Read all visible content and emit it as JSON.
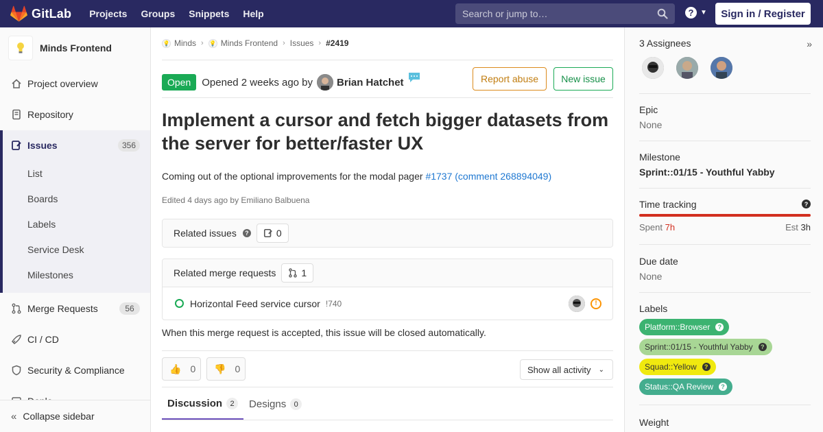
{
  "navbar": {
    "brand": "GitLab",
    "links": [
      "Projects",
      "Groups",
      "Snippets",
      "Help"
    ],
    "search_placeholder": "Search or jump to…",
    "signin": "Sign in / Register"
  },
  "sidebar": {
    "project_name": "Minds Frontend",
    "items": {
      "overview": "Project overview",
      "repository": "Repository",
      "issues": "Issues",
      "issues_count": "356",
      "merge_requests": "Merge Requests",
      "mr_count": "56",
      "cicd": "CI / CD",
      "security": "Security & Compliance",
      "deploy_partial": "Deplo"
    },
    "issue_subitems": [
      "List",
      "Boards",
      "Labels",
      "Service Desk",
      "Milestones"
    ],
    "collapse": "Collapse sidebar"
  },
  "breadcrumb": {
    "group": "Minds",
    "project": "Minds Frontend",
    "section": "Issues",
    "current": "#2419"
  },
  "issue": {
    "state": "Open",
    "opened_text": "Opened 2 weeks ago by",
    "author": "Brian Hatchet",
    "report_abuse": "Report abuse",
    "new_issue": "New issue",
    "title": "Implement a cursor and fetch bigger datasets from the server for better/faster UX",
    "description_prefix": "Coming out of the optional improvements for the modal pager",
    "description_link1": "#1737",
    "description_link2": "(comment 268894049)",
    "edited": "Edited 4 days ago by Emiliano Balbuena"
  },
  "related_issues": {
    "label": "Related issues",
    "count": "0"
  },
  "related_mrs": {
    "label": "Related merge requests",
    "count": "1",
    "items": [
      {
        "title": "Horizontal Feed service cursor",
        "ref": "!740"
      }
    ]
  },
  "auto_close_note": "When this merge request is accepted, this issue will be closed automatically.",
  "awards": {
    "thumbs_up": "0",
    "thumbs_down": "0"
  },
  "activity_filter": "Show all activity",
  "tabs": [
    {
      "label": "Discussion",
      "count": "2"
    },
    {
      "label": "Designs",
      "count": "0"
    }
  ],
  "right_sidebar": {
    "assignees_label": "3 Assignees",
    "epic_label": "Epic",
    "epic_value": "None",
    "milestone_label": "Milestone",
    "milestone_value": "Sprint::01/15 - Youthful Yabby",
    "time_label": "Time tracking",
    "spent_label": "Spent",
    "spent_value": "7h",
    "est_label": "Est",
    "est_value": "3h",
    "due_label": "Due date",
    "due_value": "None",
    "labels_label": "Labels",
    "labels": [
      {
        "text": "Platform::Browser",
        "bg": "#3cb371",
        "fg": "#ffffff"
      },
      {
        "text": "Sprint::01/15 - Youthful Yabby",
        "bg": "#a8d695",
        "fg": "#333333"
      },
      {
        "text": "Squad::Yellow",
        "bg": "#f0e90f",
        "fg": "#333333"
      },
      {
        "text": "Status::QA Review",
        "bg": "#44ad8e",
        "fg": "#ffffff"
      }
    ],
    "weight_label": "Weight"
  },
  "colors": {
    "navbar": "#292961",
    "open_state": "#1aaa55",
    "link": "#1f78d1",
    "time_over": "#d22f1f"
  }
}
